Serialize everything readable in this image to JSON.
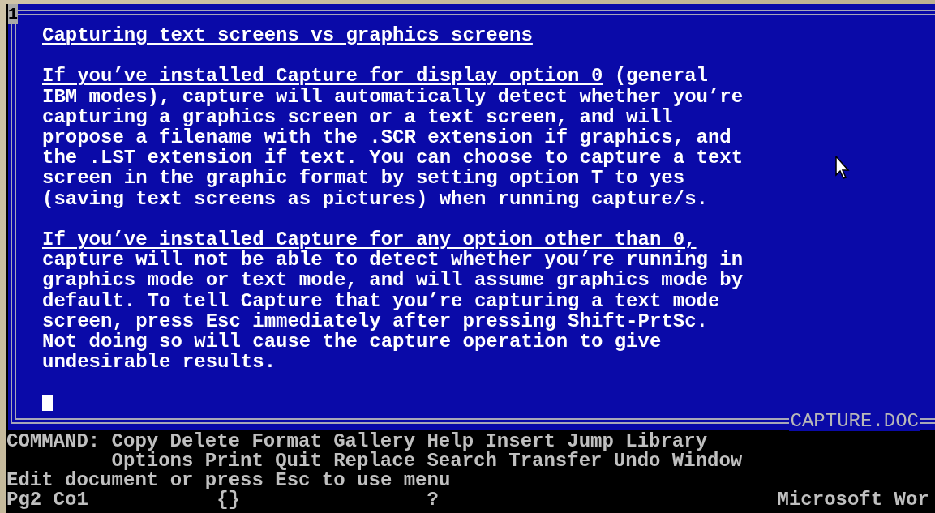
{
  "window": {
    "number": "1",
    "filename": "CAPTURE.DOC"
  },
  "document": {
    "heading": "Capturing text screens vs graphics screens",
    "paragraphs": [
      {
        "lead": "If you’ve installed Capture for display option 0",
        "rest": "(general",
        "lines": [
          "IBM modes), capture will automatically detect whether you’re",
          "capturing a graphics screen or a text screen, and will",
          "propose a filename with the .SCR extension if graphics, and",
          "the .LST extension if text. You can choose to capture a text",
          "screen in the graphic format by setting option T to yes",
          "(saving text screens as pictures) when running capture/s."
        ]
      },
      {
        "lead": "If you’ve installed Capture for any option other than 0,",
        "lines": [
          "capture will not be able to detect whether you’re running in",
          "graphics mode or text mode, and will assume graphics mode by",
          "default. To tell Capture that you’re capturing a text mode",
          "screen, press Esc immediately after pressing Shift-PrtSc.",
          "Not doing so will cause the capture operation to give",
          "undesirable results."
        ]
      }
    ],
    "cursor": true
  },
  "command_menu": {
    "label": "COMMAND:",
    "first_line": [
      "Copy",
      "Delete",
      "Format",
      "Gallery",
      "Help",
      "Insert",
      "Jump",
      "Library"
    ],
    "second_line": [
      "Options",
      "Print",
      "Quit",
      "Replace",
      "Search",
      "Transfer",
      "Undo",
      "Window"
    ]
  },
  "message": "Edit document or press Esc to use menu",
  "status_bar": {
    "position": "Pg2 Co1",
    "column_2": "{}",
    "column_3": "?",
    "app_name": "Microsoft Wor"
  }
}
